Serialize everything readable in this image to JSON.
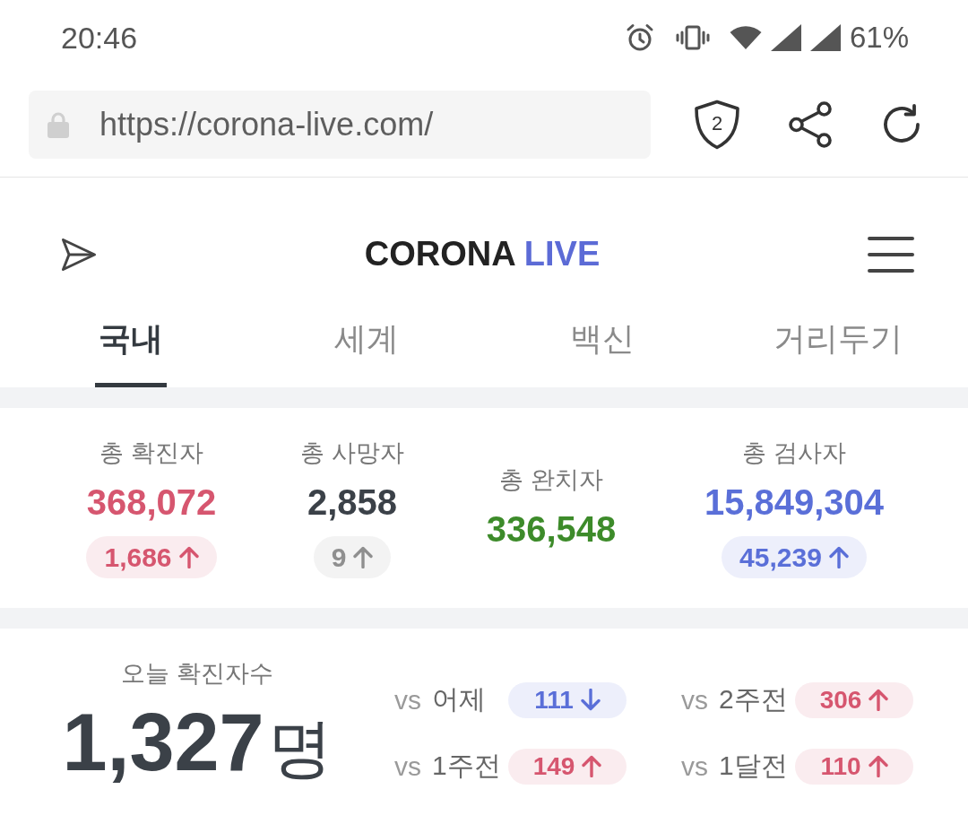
{
  "status_bar": {
    "time": "20:46",
    "battery": "61%"
  },
  "browser": {
    "url": "https://corona-live.com/",
    "tracker_count": "2"
  },
  "header": {
    "logo": {
      "primary": "CORONA",
      "accent": "LIVE"
    }
  },
  "tabs": [
    {
      "label": "국내",
      "selected": true
    },
    {
      "label": "세계",
      "selected": false
    },
    {
      "label": "백신",
      "selected": false
    },
    {
      "label": "거리두기",
      "selected": false
    }
  ],
  "stats": [
    {
      "label": "총 확진자",
      "value": "368,072",
      "color": "#d6566f",
      "change": {
        "value": "1,686",
        "kind": "up",
        "color": "#d6566f"
      }
    },
    {
      "label": "총 사망자",
      "value": "2,858",
      "color": "#3b4148",
      "change": {
        "value": "9",
        "kind": "up",
        "color": "#8f8f8f"
      }
    },
    {
      "label": "총 완치자",
      "value": "336,548",
      "color": "#3d8b2a"
    },
    {
      "label": "총 검사자",
      "value": "15,849,304",
      "color": "#5a6fd8",
      "change": {
        "value": "45,239",
        "kind": "up",
        "color": "#5a6fd8"
      }
    }
  ],
  "today": {
    "label": "오늘 확진자수",
    "value": "1,327",
    "unit": "명",
    "comparisons": [
      {
        "prefix": "vs",
        "label": "어제",
        "change": "111",
        "kind": "down",
        "color": "#5a6fd8"
      },
      {
        "prefix": "vs",
        "label": "2주전",
        "change": "306",
        "kind": "up",
        "color": "#d6566f"
      },
      {
        "prefix": "vs",
        "label": "1주전",
        "change": "149",
        "kind": "up",
        "color": "#d6566f"
      },
      {
        "prefix": "vs",
        "label": "1달전",
        "change": "110",
        "kind": "up",
        "color": "#d6566f"
      }
    ]
  }
}
